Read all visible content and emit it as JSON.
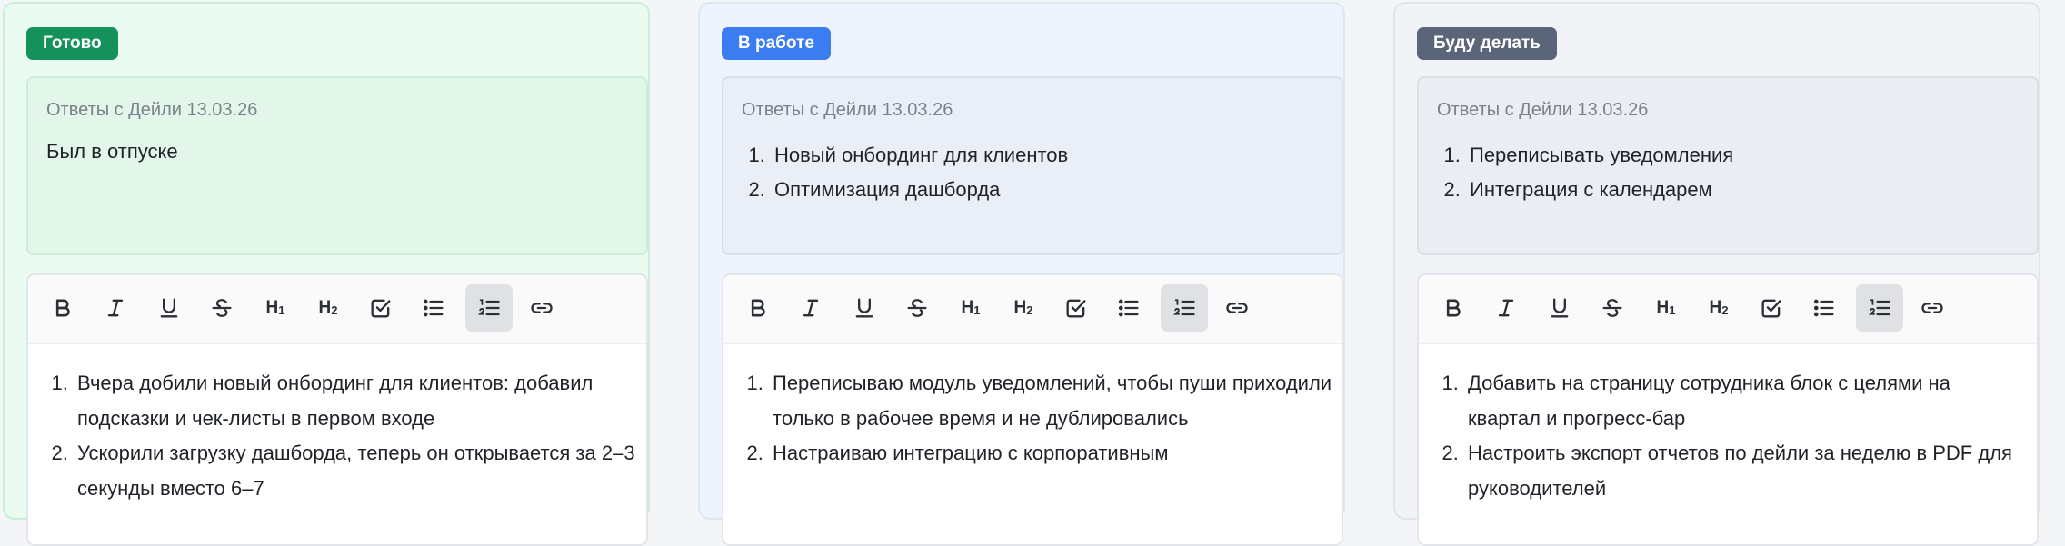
{
  "columns": [
    {
      "status": "Готово",
      "status_color": "#15915c",
      "answers_title": "Ответы с Дейли 13.03.26",
      "answers_text": "Был в отпуске",
      "answers_items": [],
      "editor_items": [
        "Вчера добили новый онбординг для клиентов: добавил подсказки и чек-листы в первом входе",
        "Ускорили загрузку дашборда, теперь он открывается за 2–3 секунды вместо 6–7"
      ]
    },
    {
      "status": "В работе",
      "status_color": "#3b7cf0",
      "answers_title": "Ответы с Дейли 13.03.26",
      "answers_text": "",
      "answers_items": [
        "Новый онбординг для клиентов",
        "Оптимизация дашборда"
      ],
      "editor_items": [
        "Переписываю модуль уведомлений, чтобы пуши приходили только в рабочее время и не дублировались",
        "Настраиваю интеграцию с корпоративным"
      ]
    },
    {
      "status": "Буду делать",
      "status_color": "#5a657a",
      "answers_title": "Ответы с Дейли 13.03.26",
      "answers_text": "",
      "answers_items": [
        "Переписывать уведомления",
        "Интеграция с календарем"
      ],
      "editor_items": [
        "Добавить на страницу сотрудника блок с целями на квартал и прогресс-бар",
        "Настроить экспорт отчетов по дейли за неделю в PDF для руководителей"
      ]
    }
  ],
  "toolbar": {
    "buttons": [
      {
        "icon": "bold-icon",
        "active": false
      },
      {
        "icon": "italic-icon",
        "active": false
      },
      {
        "icon": "underline-icon",
        "active": false
      },
      {
        "icon": "strikethrough-icon",
        "active": false
      },
      {
        "icon": "heading-1-icon",
        "active": false
      },
      {
        "icon": "heading-2-icon",
        "active": false
      },
      {
        "icon": "checklist-icon",
        "active": false
      },
      {
        "icon": "bullet-list-icon",
        "active": false
      },
      {
        "icon": "ordered-list-icon",
        "active": true
      },
      {
        "icon": "link-icon",
        "active": false
      }
    ]
  }
}
